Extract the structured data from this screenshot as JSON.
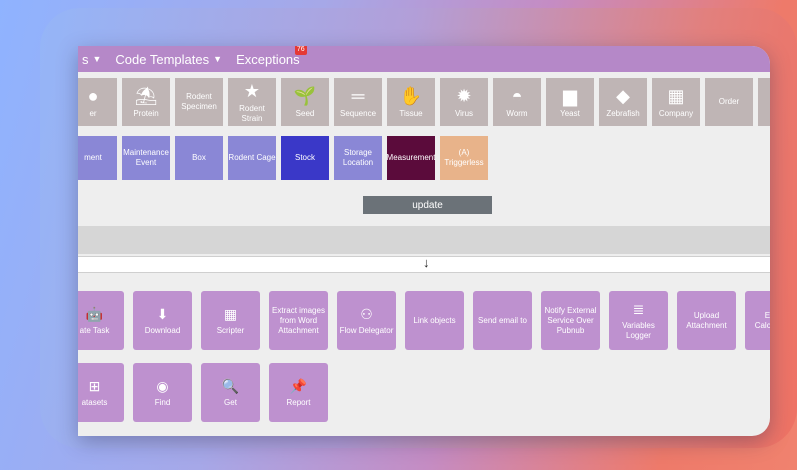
{
  "menubar": {
    "items": [
      {
        "label": "s",
        "caret": "▼"
      },
      {
        "label": "Code Templates",
        "caret": "▼"
      },
      {
        "label": "Exceptions",
        "badge": "76"
      }
    ]
  },
  "entity_row1": [
    {
      "label": "er",
      "icon": "●"
    },
    {
      "label": "Protein",
      "icon": "⛱"
    },
    {
      "label": "Rodent Specimen",
      "icon": ""
    },
    {
      "label": "Rodent Strain",
      "icon": "★"
    },
    {
      "label": "Seed",
      "icon": "🌱"
    },
    {
      "label": "Sequence",
      "icon": "═"
    },
    {
      "label": "Tissue",
      "icon": "✋"
    },
    {
      "label": "Virus",
      "icon": "✹"
    },
    {
      "label": "Worm",
      "icon": "◓"
    },
    {
      "label": "Yeast",
      "icon": "▆"
    },
    {
      "label": "Zebrafish",
      "icon": "◆"
    },
    {
      "label": "Company",
      "icon": "▦"
    },
    {
      "label": "Order",
      "icon": ""
    },
    {
      "label": "C",
      "icon": ""
    }
  ],
  "entity_row2": [
    {
      "label": "ment",
      "style": "purple"
    },
    {
      "label": "Maintenance Event",
      "style": "purple"
    },
    {
      "label": "Box",
      "style": "purple"
    },
    {
      "label": "Rodent Cage",
      "style": "purple"
    },
    {
      "label": "Stock",
      "style": "deep"
    },
    {
      "label": "Storage Location",
      "style": "purple"
    },
    {
      "label": "Measurement",
      "style": "maroon"
    },
    {
      "label": "(A) Triggerless",
      "style": "peach"
    }
  ],
  "update_label": "update",
  "arrow_glyph": "↓",
  "actions_row1": [
    {
      "label": "ate Task",
      "icon": "🤖"
    },
    {
      "label": "Download",
      "icon": "⬇"
    },
    {
      "label": "Scripter",
      "icon": "▦"
    },
    {
      "label": "Extract images from Word Attachment",
      "icon": ""
    },
    {
      "label": "Flow Delegator",
      "icon": "⚇"
    },
    {
      "label": "Link objects",
      "icon": ""
    },
    {
      "label": "Send email to",
      "icon": ""
    },
    {
      "label": "Notify External Service Over Pubnub",
      "icon": ""
    },
    {
      "label": "Variables Logger",
      "icon": "≣"
    },
    {
      "label": "Upload Attachment",
      "icon": ""
    },
    {
      "label": "Excel Calculation",
      "icon": ""
    }
  ],
  "actions_row2": [
    {
      "label": "atasets",
      "icon": "⊞"
    },
    {
      "label": "Find",
      "icon": "◉"
    },
    {
      "label": "Get",
      "icon": "🔍"
    },
    {
      "label": "Report",
      "icon": "📌"
    }
  ]
}
